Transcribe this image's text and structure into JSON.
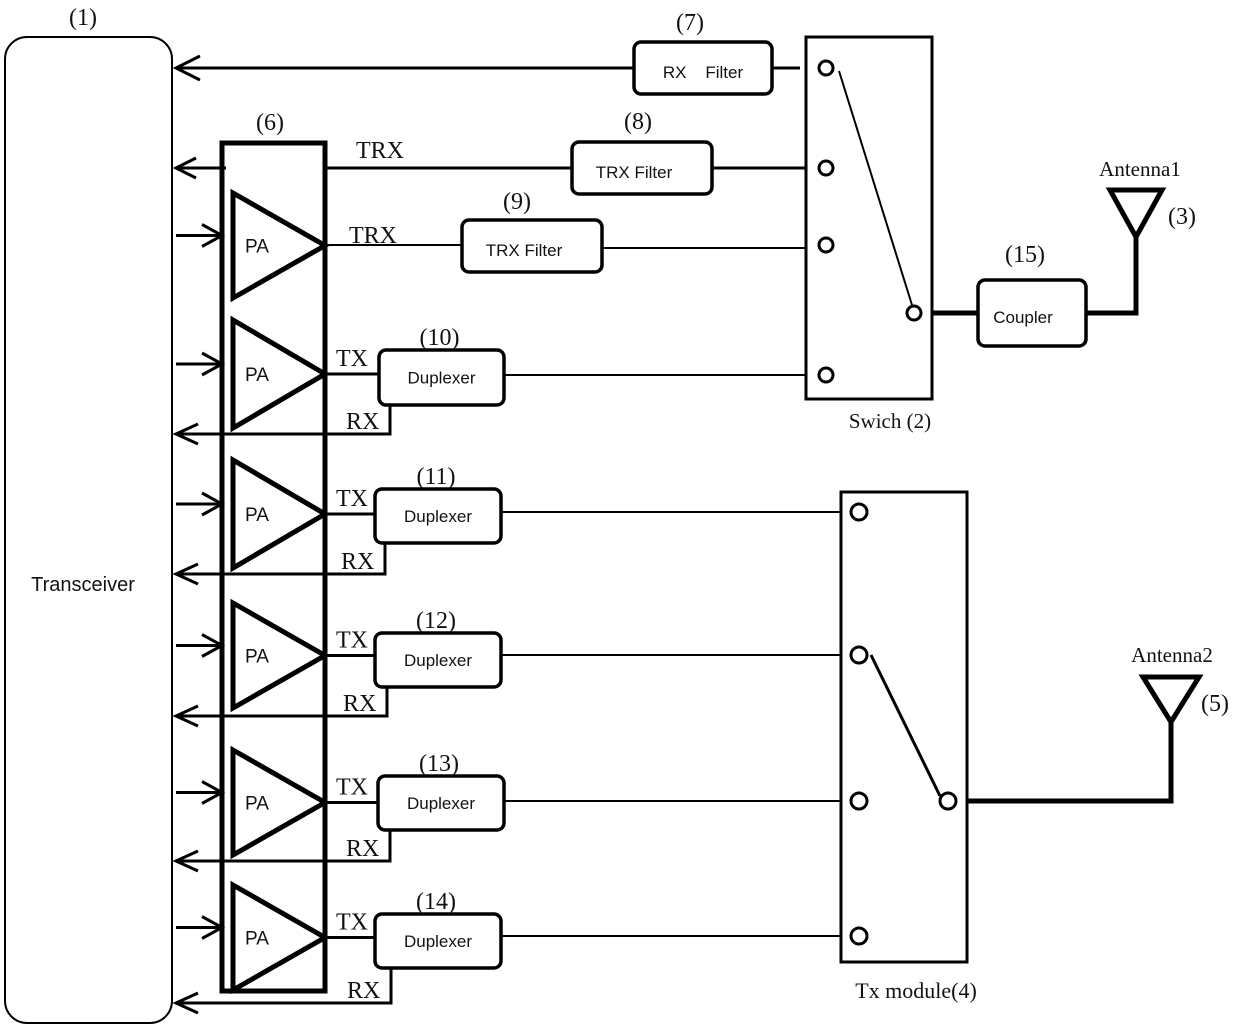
{
  "diagram": {
    "transceiver": {
      "ref": "(1)",
      "label": "Transceiver"
    },
    "pa_module": {
      "ref": "(6)",
      "amplifier_label": "PA",
      "amplifier_count": 6
    },
    "switch": {
      "label": "Swich (2)",
      "ports": 5
    },
    "antenna1": {
      "label": "Antenna1",
      "ref": "(3)"
    },
    "antenna2": {
      "label": "Antenna2",
      "ref": "(5)"
    },
    "tx_module": {
      "label": "Tx module(4)",
      "ports": 5
    },
    "coupler": {
      "ref": "(15)",
      "label": "Coupler"
    },
    "filters": [
      {
        "ref": "(7)",
        "label": "RX    Filter"
      },
      {
        "ref": "(8)",
        "label": "TRX Filter"
      },
      {
        "ref": "(9)",
        "label": "TRX Filter"
      }
    ],
    "duplexers": [
      {
        "ref": "(10)",
        "label": "Duplexer"
      },
      {
        "ref": "(11)",
        "label": "Duplexer"
      },
      {
        "ref": "(12)",
        "label": "Duplexer"
      },
      {
        "ref": "(13)",
        "label": "Duplexer"
      },
      {
        "ref": "(14)",
        "label": "Duplexer"
      }
    ],
    "signal_labels": {
      "trx": "TRX",
      "tx": "TX",
      "rx": "RX"
    }
  }
}
